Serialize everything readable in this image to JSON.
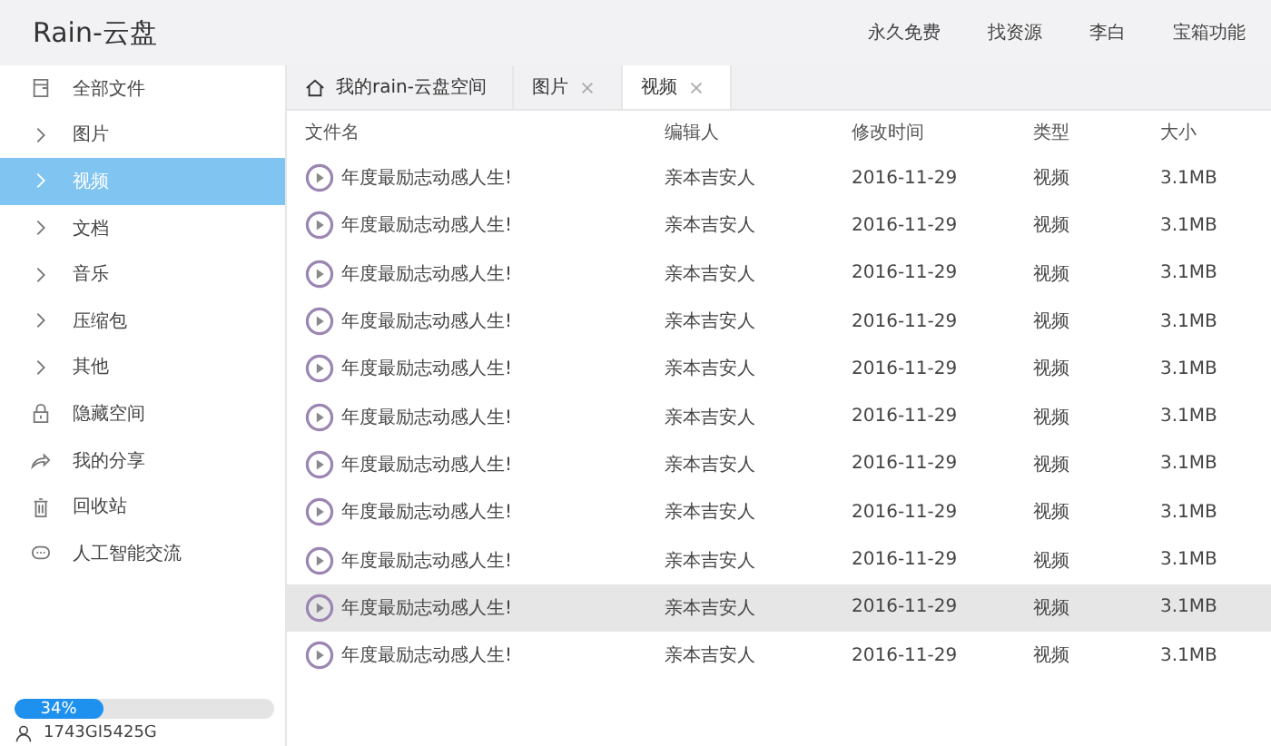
{
  "app_title": "Rain-云盘",
  "top_menu": [
    {
      "label": "永久免费"
    },
    {
      "label": "找资源"
    },
    {
      "label": "李白"
    },
    {
      "label": "宝箱功能"
    }
  ],
  "sidebar": {
    "items": [
      {
        "label": "全部文件",
        "kind": "file",
        "selected": false
      },
      {
        "label": "图片",
        "kind": "folder",
        "selected": false
      },
      {
        "label": "视频",
        "kind": "folder",
        "selected": true
      },
      {
        "label": "文档",
        "kind": "folder",
        "selected": false
      },
      {
        "label": "音乐",
        "kind": "folder",
        "selected": false
      },
      {
        "label": "压缩包",
        "kind": "folder",
        "selected": false
      },
      {
        "label": "其他",
        "kind": "folder",
        "selected": false
      },
      {
        "label": "隐藏空间",
        "kind": "lock",
        "selected": false
      },
      {
        "label": "我的分享",
        "kind": "share",
        "selected": false
      },
      {
        "label": "回收站",
        "kind": "trash",
        "selected": false
      },
      {
        "label": "人工智能交流",
        "kind": "chat",
        "selected": false
      }
    ],
    "storage": {
      "level": 0.34,
      "reading": "34%"
    },
    "account": "1743GI5425G"
  },
  "tabs": [
    {
      "label": "我的rain-云盘空间",
      "kind": "home",
      "selected": false
    },
    {
      "label": "图片",
      "kind": "closable",
      "selected": false
    },
    {
      "label": "视频",
      "kind": "closable",
      "selected": true
    }
  ],
  "table": {
    "columns": [
      "文件名",
      "编辑人",
      "修改时间",
      "类型",
      "大小"
    ],
    "rows": [
      {
        "name": "年度最励志动感人生!",
        "editor": "亲本吉安人",
        "modified": "2016-11-29",
        "type": "视频",
        "size": "3.1MB",
        "selected": false
      },
      {
        "name": "年度最励志动感人生!",
        "editor": "亲本吉安人",
        "modified": "2016-11-29",
        "type": "视频",
        "size": "3.1MB",
        "selected": false
      },
      {
        "name": "年度最励志动感人生!",
        "editor": "亲本吉安人",
        "modified": "2016-11-29",
        "type": "视频",
        "size": "3.1MB",
        "selected": false
      },
      {
        "name": "年度最励志动感人生!",
        "editor": "亲本吉安人",
        "modified": "2016-11-29",
        "type": "视频",
        "size": "3.1MB",
        "selected": false
      },
      {
        "name": "年度最励志动感人生!",
        "editor": "亲本吉安人",
        "modified": "2016-11-29",
        "type": "视频",
        "size": "3.1MB",
        "selected": false
      },
      {
        "name": "年度最励志动感人生!",
        "editor": "亲本吉安人",
        "modified": "2016-11-29",
        "type": "视频",
        "size": "3.1MB",
        "selected": false
      },
      {
        "name": "年度最励志动感人生!",
        "editor": "亲本吉安人",
        "modified": "2016-11-29",
        "type": "视频",
        "size": "3.1MB",
        "selected": false
      },
      {
        "name": "年度最励志动感人生!",
        "editor": "亲本吉安人",
        "modified": "2016-11-29",
        "type": "视频",
        "size": "3.1MB",
        "selected": false
      },
      {
        "name": "年度最励志动感人生!",
        "editor": "亲本吉安人",
        "modified": "2016-11-29",
        "type": "视频",
        "size": "3.1MB",
        "selected": false
      },
      {
        "name": "年度最励志动感人生!",
        "editor": "亲本吉安人",
        "modified": "2016-11-29",
        "type": "视频",
        "size": "3.1MB",
        "selected": true
      },
      {
        "name": "年度最励志动感人生!",
        "editor": "亲本吉安人",
        "modified": "2016-11-29",
        "type": "视频",
        "size": "3.1MB",
        "selected": false
      }
    ]
  }
}
